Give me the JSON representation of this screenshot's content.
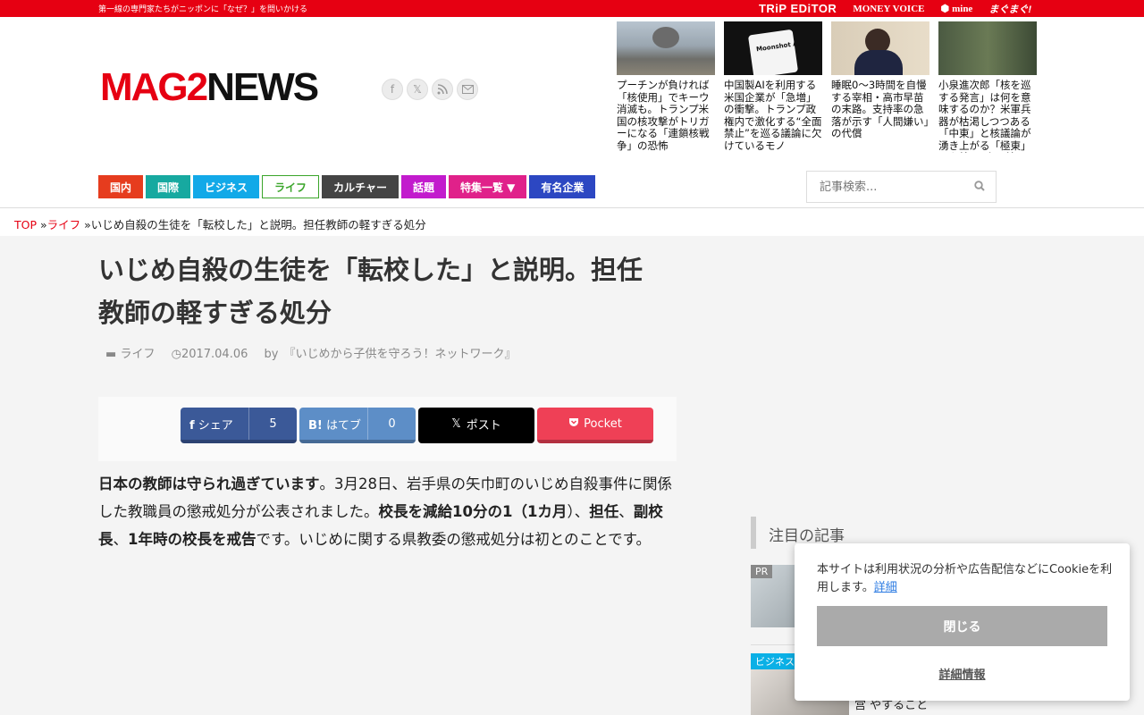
{
  "topbar": {
    "tagline": "第一線の専門家たちがニッポンに「なぜ？」を問いかける",
    "sites": [
      "TRiP EDiTOR",
      "MONEY VOICE",
      "mine",
      "まぐまぐ!"
    ]
  },
  "logo": {
    "part1": "MAG2",
    "part2": "NEWS"
  },
  "header_articles": [
    {
      "title": "プーチンが負ければ「核使用」でキーウ消滅も。トランプ米国の核攻撃がトリガーになる「連鎖核戦争」の恐怖"
    },
    {
      "title": "中国製AIを利用する米国企業が「急増」の衝撃。トランプ政権内で激化する“全面禁止”を巡る議論に欠けているモノ",
      "thumb_text": "Moonshot AI"
    },
    {
      "title": "睡眠0〜3時間を自慢する宰相・高市早苗の末路。支持率の急落が示す「人間嫌い」の代償"
    },
    {
      "title": "小泉進次郎「核を巡する発言」は何を意味するのか？米軍兵器が枯渇しつつある「中東」と核議論が湧き上がる「極東」とを結ぶ“点と線”"
    }
  ],
  "nav": [
    {
      "label": "国内",
      "color": "#e63c1e"
    },
    {
      "label": "国際",
      "color": "#17a9a0"
    },
    {
      "label": "ビジネス",
      "color": "#12a9e8"
    },
    {
      "label": "ライフ",
      "color": "#ffffff"
    },
    {
      "label": "カルチャー",
      "color": "#444444"
    },
    {
      "label": "話題",
      "color": "#c21bcd"
    },
    {
      "label": "特集一覧 ▼",
      "color": "#e0218a"
    },
    {
      "label": "有名企業",
      "color": "#2c47c2"
    }
  ],
  "search": {
    "placeholder": "記事検索..."
  },
  "breadcrumb": {
    "top": "TOP",
    "sep1": " »",
    "cat": "ライフ",
    "sep2": " »",
    "current": "いじめ自殺の生徒を「転校した」と説明。担任教師の軽すぎる処分"
  },
  "article": {
    "title": "いじめ自殺の生徒を「転校した」と説明。担任教師の軽すぎる処分",
    "category": "ライフ",
    "date": "2017.04.06",
    "by": "by",
    "author": "『いじめから子供を守ろう！ネットワーク』",
    "body": {
      "b1": "日本の教師は守られ過ぎています",
      "t1": "。3月28日、岩手県の矢巾町のいじめ自殺事件に関係した教職員の懲戒処分が公表されました。",
      "b2": "校長を減給10分の1（1カ月",
      "t2": "）、",
      "b3": "担任",
      "t3": "、",
      "b4": "副校長",
      "t4": "、",
      "b5": "1年時の校長を戒告",
      "t5": "です。いじめに関する県教委の懲戒処分は初とのことです。"
    }
  },
  "share": {
    "fb_label": "シェア",
    "fb_count": "5",
    "hb_label": "はてブ",
    "hb_count": "0",
    "x_label": "ポスト",
    "pocket_label": "Pocket"
  },
  "sidebar": {
    "heading": "注目の記事",
    "pr": "PR",
    "biz": "ビジネス",
    "item2_text": "営 やすること"
  },
  "cookie": {
    "message": "本サイトは利用状況の分析や広告配信などにCookieを利用します。",
    "detail_link": "詳細",
    "close": "閉じる",
    "more": "詳細情報"
  }
}
